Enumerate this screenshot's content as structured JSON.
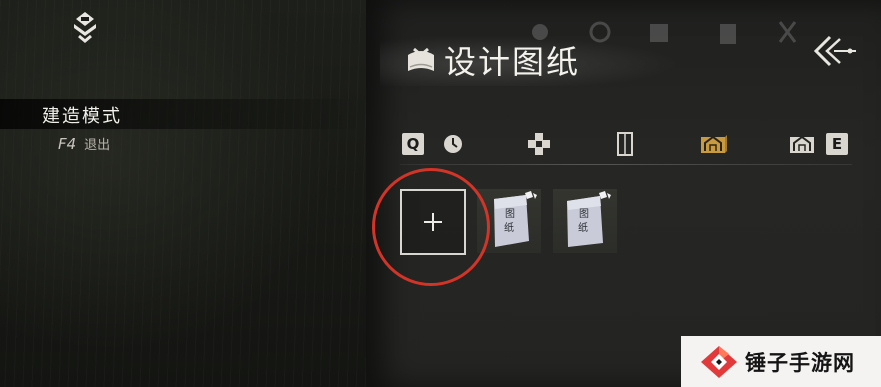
{
  "mode": {
    "title": "建造模式",
    "exit_key": "F4",
    "exit_label": "退出"
  },
  "panel": {
    "title": "设计图纸"
  },
  "tabs": {
    "prev_key": "Q",
    "next_key": "E",
    "items": [
      {
        "icon": "clock-icon",
        "selected": false
      },
      {
        "icon": "cross-tile-icon",
        "selected": false
      },
      {
        "icon": "door-icon",
        "selected": false
      },
      {
        "icon": "house-blueprint-icon",
        "selected": true
      },
      {
        "icon": "house-blueprint-outline-icon",
        "selected": false
      }
    ]
  },
  "slots": {
    "add_label": "+",
    "blueprints": [
      {
        "label_line1": "图",
        "label_line2": "纸"
      },
      {
        "label_line1": "图",
        "label_line2": "纸"
      }
    ]
  },
  "watermark": {
    "text": "锤子手游网"
  },
  "colors": {
    "accent_gold": "#c99a3e",
    "highlight_circle": "#d23428",
    "watermark_red": "#e23a3a"
  }
}
